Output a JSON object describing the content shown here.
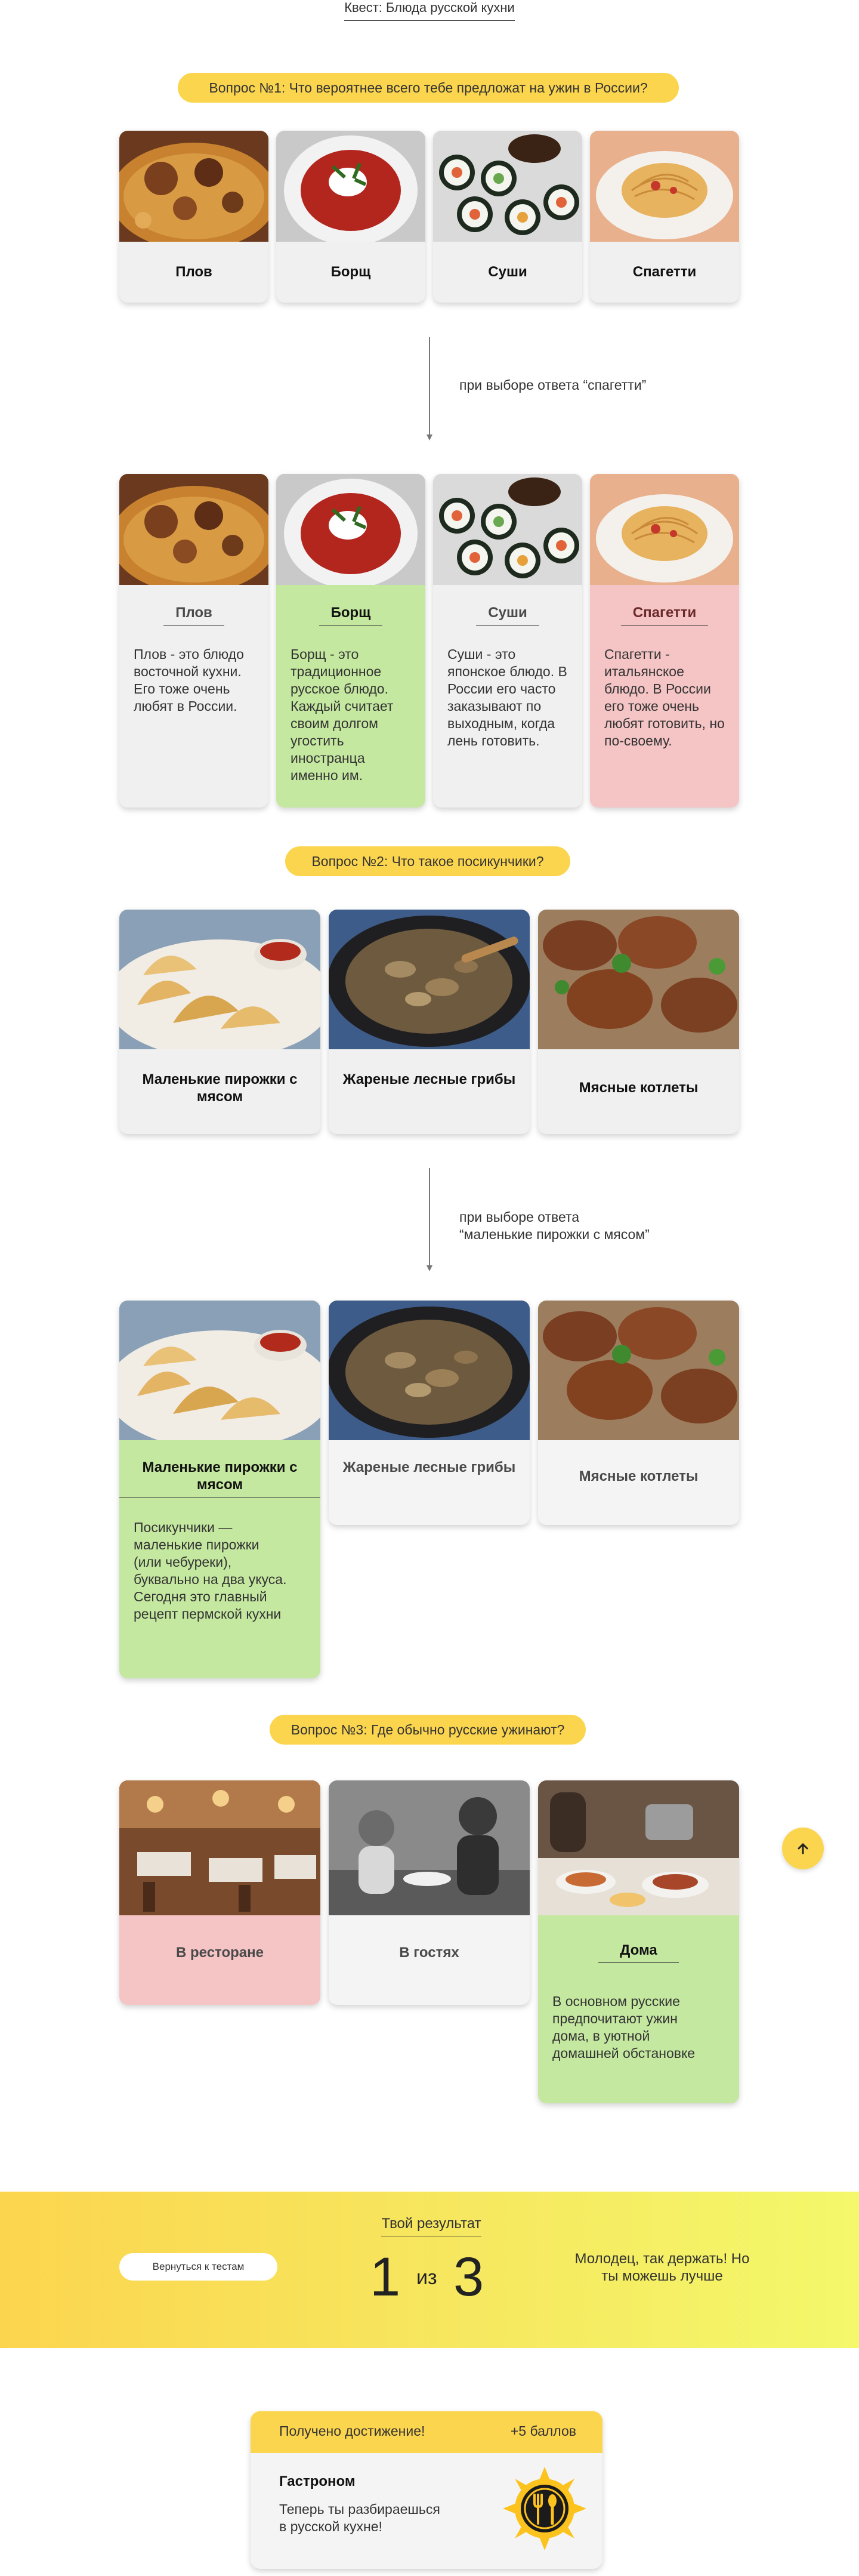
{
  "quest": {
    "title": "Квест: Блюда русской кухни"
  },
  "questions": {
    "q1": "Вопрос №1: Что вероятнее всего тебе предложат на ужин в России?",
    "q2": "Вопрос №2: Что такое посикунчики?",
    "q3": "Вопрос №3: Где обычно русские ужинают?"
  },
  "q1_options": [
    {
      "label": "Плов",
      "image": "plov-image"
    },
    {
      "label": "Борщ",
      "image": "borscht-image"
    },
    {
      "label": "Суши",
      "image": "sushi-image"
    },
    {
      "label": "Спагетти",
      "image": "spaghetti-image"
    }
  ],
  "q1_note": "при выборе ответа “спагетти”",
  "q1_answers": [
    {
      "label": "Плов",
      "desc": "Плов - это блюдо восточной кухни. Его тоже очень любят в России."
    },
    {
      "label": "Борщ",
      "desc": "Борщ - это традиционное русское блюдо. Каждый считает своим долгом угостить иностранца именно им."
    },
    {
      "label": "Суши",
      "desc": "Суши - это японское блюдо. В России его часто заказывают по выходным, когда лень готовить."
    },
    {
      "label": "Спагетти",
      "desc": "Спагетти - итальянское блюдо. В России его тоже очень любят готовить, но по-своему."
    }
  ],
  "q2_options": [
    {
      "label": "Маленькие пирожки с мясом"
    },
    {
      "label": "Жареные лесные грибы"
    },
    {
      "label": "Мясные котлеты"
    }
  ],
  "q2_note": "при выборе ответа “маленькие пирожки с мясом”",
  "q2_answer_desc": "Посикунчики — маленькие пирожки (или чебуреки), буквально на два укуса. Сегодня это главный рецепт пермской кухни",
  "q3_options": [
    {
      "label": "В ресторане"
    },
    {
      "label": "В гостях"
    },
    {
      "label": "Дома",
      "desc": "В основном русские предпочитают ужин дома, в уютной домашней обстановке"
    }
  ],
  "result": {
    "back_label": "Вернуться к тестам",
    "label": "Твой результат",
    "score": "1",
    "of": "из",
    "total": "3",
    "praise": "Молодец, так держать! Но ты можешь лучше"
  },
  "achievement": {
    "header": "Получено достижение!",
    "points": "+5 баллов",
    "name": "Гастроном",
    "desc": "Теперь ты разбираешься в русской кухне!"
  },
  "colors": {
    "accent_yellow": "#fcd54e",
    "correct_green": "#c5e8a0",
    "wrong_pink": "#f5c4c5",
    "card_gray": "#f0f0f0"
  },
  "icons": {
    "scroll_top": "arrow-up-icon",
    "badge": "fork-spoon-icon"
  }
}
